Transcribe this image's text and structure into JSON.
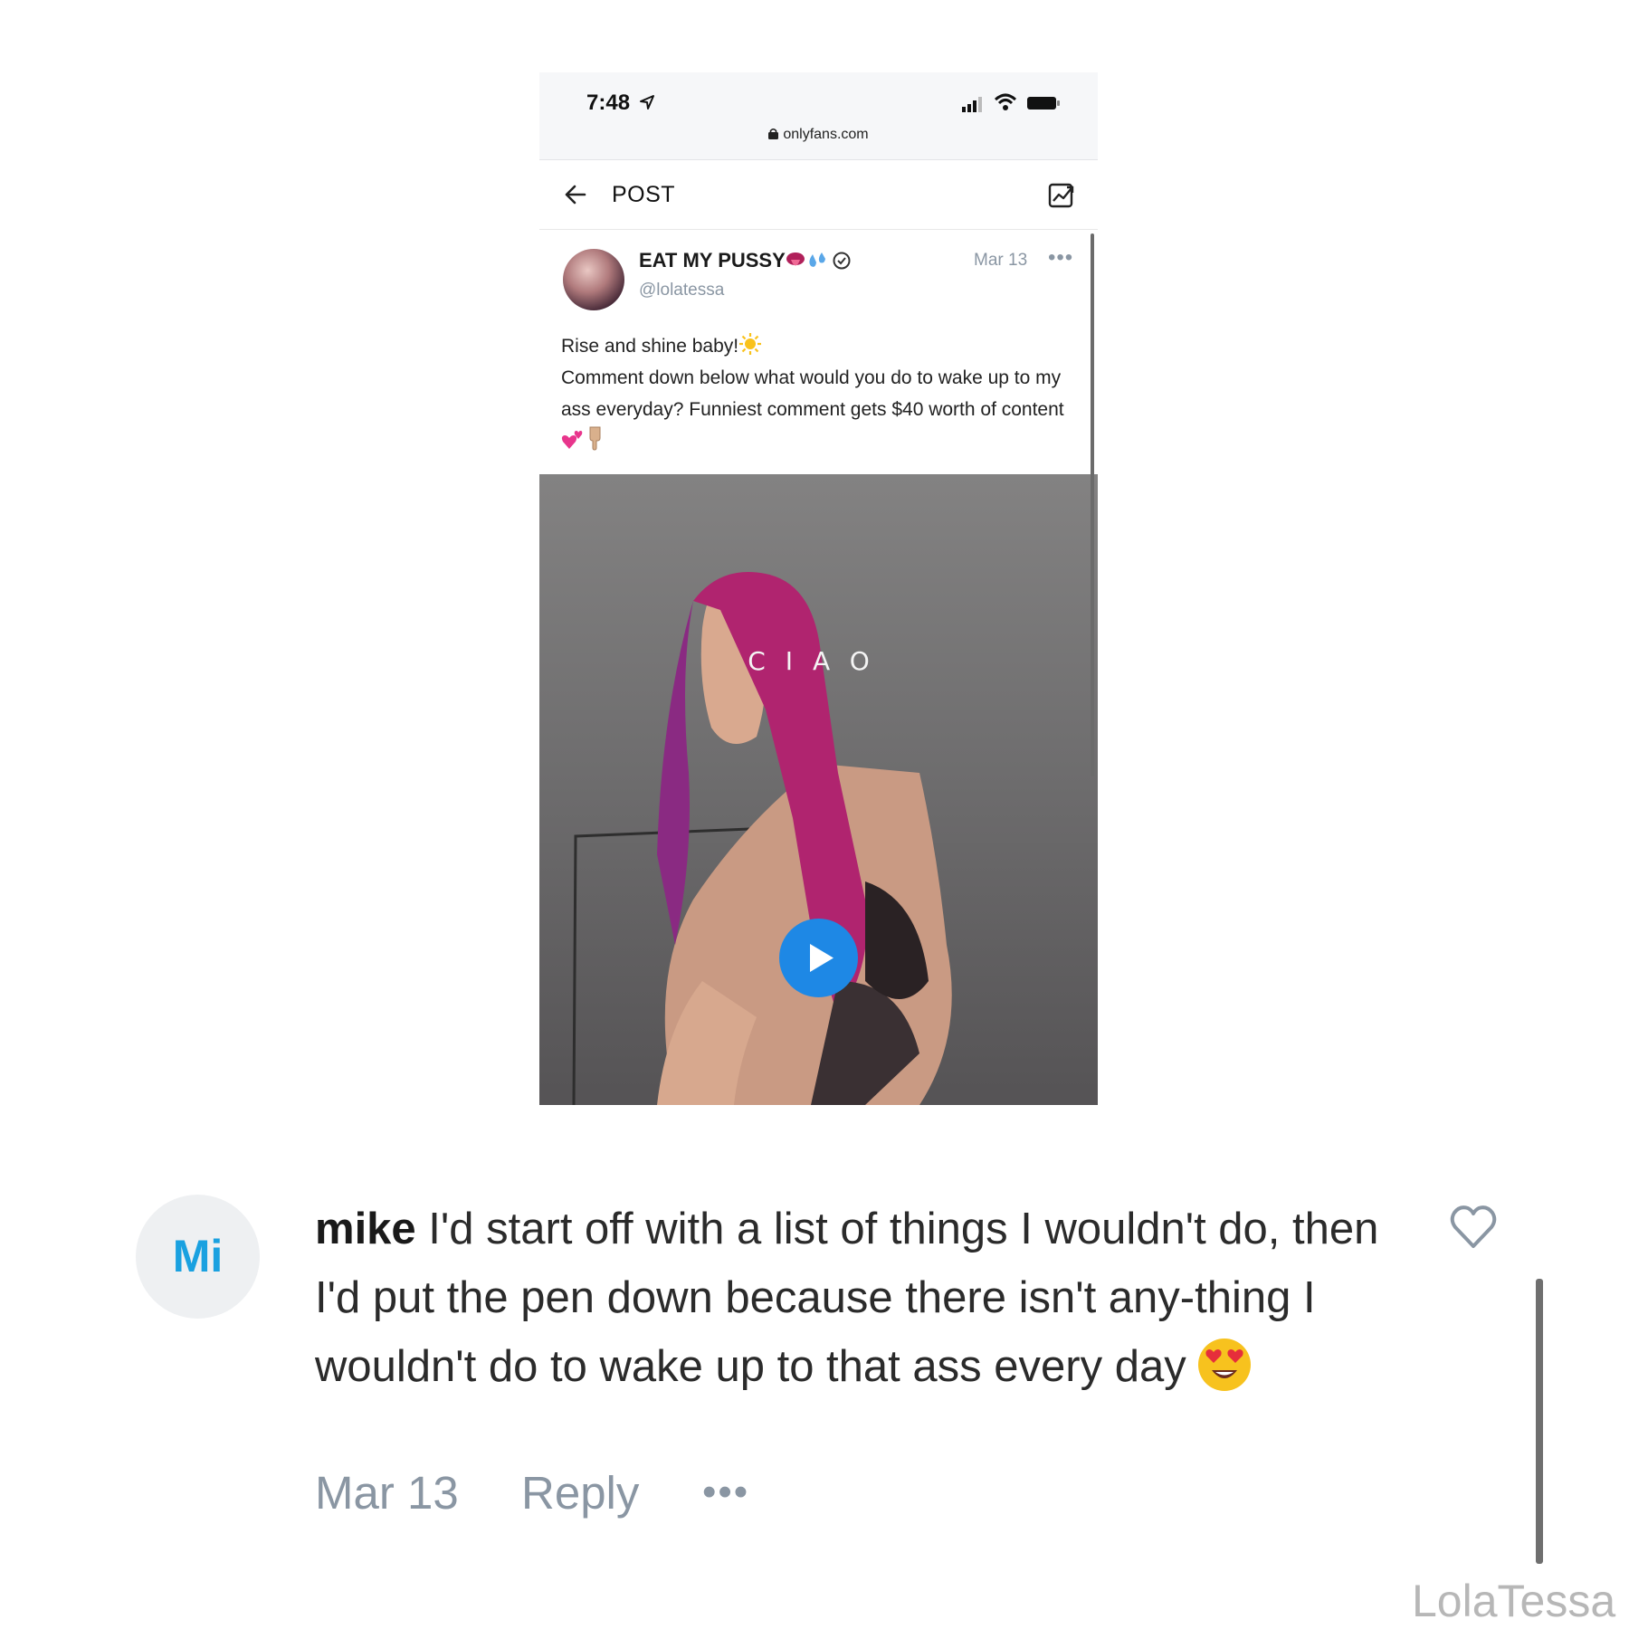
{
  "status_bar": {
    "time": "7:48",
    "url": "onlyfans.com",
    "icons": [
      "location-arrow-icon",
      "signal-icon",
      "wifi-icon",
      "battery-icon",
      "lock-icon"
    ]
  },
  "nav": {
    "title": "POST",
    "icons": [
      "back-arrow-icon",
      "statistics-icon"
    ]
  },
  "post": {
    "display_name": "EAT MY PUSSY",
    "username": "@lolatessa",
    "date": "Mar 13",
    "more": "•••",
    "text_line1": "Rise and shine baby!",
    "text_line2": "Comment down below what would you do to wake up to my ass everyday? Funniest comment gets $40 worth of content",
    "media_caption": "CIAO",
    "colors": {
      "play_button": "#1e88e5",
      "muted_text": "#8a96a3"
    }
  },
  "comment": {
    "avatar_initials": "Mi",
    "author": "mike",
    "text": " I'd start off with a list of things I wouldn't do, then I'd put the pen down because there isn't any-thing I wouldn't do to wake up to that ass every day",
    "date": "Mar 13",
    "reply_label": "Reply",
    "more": "•••",
    "colors": {
      "avatar_text": "#1aa1e0"
    }
  },
  "watermark": "LolaTessa"
}
